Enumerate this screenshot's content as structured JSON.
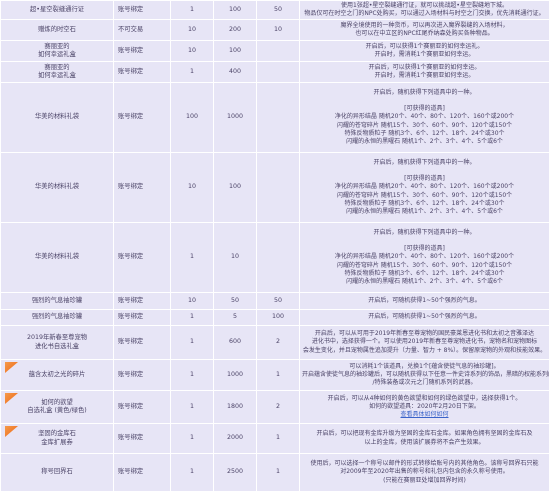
{
  "rows": [
    {
      "name": "超•星空裂缝通行证",
      "trade": "账号绑定",
      "a": "1",
      "b": "100",
      "c": "50",
      "promo": false,
      "desc": [
        "使用1张超•星空裂缝通行证，就可以挑战超•星空裂缝地下城。",
        "物品仅可在时空之门的NPC处购买，可以通过入场材料与时空之门交换，优先消耗通行证。"
      ]
    },
    {
      "name": "赠炼的时空石",
      "trade": "不可交易",
      "a": "10",
      "b": "200",
      "c": "10",
      "promo": false,
      "desc": [
        "魔界全境使用的一种货币，可以再次进入魔界裂缝的入场材料，",
        "也可以在中立区的NPC红尾乔纳森处购买各种物品。"
      ]
    },
    {
      "name": "赛丽亚的\n如何幸运礼盒",
      "trade": "账号绑定",
      "a": "10",
      "b": "100",
      "c": "",
      "promo": false,
      "desc": [
        "开启后，可以获得1个赛丽亚的如何幸运礼。",
        "开启时，需消耗1个赛丽亚如何幸运。"
      ]
    },
    {
      "name": "赛丽亚的\n如何幸运礼盒",
      "trade": "账号绑定",
      "a": "1",
      "b": "400",
      "c": "",
      "promo": false,
      "desc": [
        "开启后，可以获得1个赛丽亚的如何幸运。",
        "开启时，需消耗1个赛丽亚如何幸运。"
      ]
    },
    {
      "name": "华美的材料礼袋",
      "trade": "账号绑定",
      "a": "100",
      "b": "1000",
      "c": "",
      "promo": false,
      "desc": [
        "开启后，随机获得下列道具中的一种。",
        "",
        "[可获得的道具]",
        "净化的异形结晶 随机20个、40个、80个、120个、160个或200个",
        "闪耀的苍穹碎片 随机15个、30个、60个、90个、120个或150个",
        "特殊反物质粒子 随机3个、6个、12个、18个、24个或30个",
        "闪耀的永恒的黑曜石 随机1个、2个、3个、4个、5个或6个"
      ]
    },
    {
      "name": "华美的材料礼袋",
      "trade": "账号绑定",
      "a": "10",
      "b": "100",
      "c": "",
      "promo": false,
      "desc": [
        "开启后，随机获得下列道具中的一种。",
        "",
        "[可获得的道具]",
        "净化的异形结晶 随机20个、40个、80个、120个、160个或200个",
        "闪耀的苍穹碎片 随机15个、30个、60个、90个、120个或150个",
        "特殊反物质粒子 随机3个、6个、12个、18个、24个或30个",
        "闪耀的永恒的黑曜石 随机1个、2个、3个、4个、5个或6个"
      ]
    },
    {
      "name": "华美的材料礼袋",
      "trade": "账号绑定",
      "a": "1",
      "b": "10",
      "c": "",
      "promo": false,
      "desc": [
        "开启后，随机获得下列道具中的一种。",
        "",
        "[可获得的道具]",
        "净化的异形结晶 随机20个、40个、80个、120个、160个或200个",
        "闪耀的苍穹碎片 随机15个、30个、60个、90个、120个或150个",
        "特殊反物质粒子 随机3个、6个、12个、18个、24个或30个",
        "闪耀的永恒的黑曜石 随机1个、2个、3个、4个、5个或6个"
      ]
    },
    {
      "name": "强烈的气息袖珍罐",
      "trade": "账号绑定",
      "a": "10",
      "b": "50",
      "c": "50",
      "promo": false,
      "desc": [
        "开启后，可随机获得1~50个强烈的气息。"
      ]
    },
    {
      "name": "强烈的气息袖珍罐",
      "trade": "账号绑定",
      "a": "1",
      "b": "5",
      "c": "100",
      "promo": false,
      "desc": [
        "开启后，可随机获得1~50个强烈的气息。"
      ]
    },
    {
      "name": "2019年新春至尊宠物\n进化书自选礼盒",
      "trade": "账号绑定",
      "a": "1",
      "b": "600",
      "c": "2",
      "promo": false,
      "desc": [
        "开启后，可以从可用于2019年新春至尊宠物的国民豪莱恩进化书和太初之音雅泽达",
        "进化书中，选择获得一个。可以使用2019年新春至尊宠物进化书，宠物名和宠物图标",
        "会发生变化，并且宠物属性追加提升（力量、智力 + 8%）。保留原宠物的外观和技能效果。"
      ]
    },
    {
      "name": "蕴含太初之光的碎片",
      "trade": "账号绑定",
      "a": "1",
      "b": "1000",
      "c": "1",
      "promo": true,
      "desc": [
        "可以消耗1个该道具，兑换1个[蕴含使徒气息的袖珍罐]。",
        "开启蕴含使徒气息的袖珍罐后，可以随机获得以下任意一件史诗系列的饰品，黑暗的权能系列的首饰",
        "/特殊装备或次元之门随机系列的武器。"
      ]
    },
    {
      "name": "如何的欲望\n自选礼盒 (黄色/绿色)",
      "trade": "账号绑定",
      "a": "1",
      "b": "1800",
      "c": "2",
      "promo": true,
      "desc": [
        "开启后，可以从4种如何的黄色欲望和如何的绿色欲望中，选择获得1个。",
        "如何的欲望道具：2020年2月20日下架。",
        "查看具体如何如何"
      ]
    },
    {
      "name": "坚固的金库石\n金库扩展券",
      "trade": "账号绑定",
      "a": "1",
      "b": "2000",
      "c": "1",
      "promo": true,
      "desc": [
        "开启后，可以把现有金库升级为坚固的金库石金库。如果角色拥有坚固的金库石及",
        "以上的金库，使用该扩展券将不会产生效果。"
      ]
    },
    {
      "name": "称号回界石",
      "trade": "账号绑定",
      "a": "1",
      "b": "2500",
      "c": "1",
      "promo": false,
      "desc": [
        "使用后，可以选择一个称号以邮件的形式转移给账号内的其他角色。该称号回界石只能",
        "对2009年至2020年出售的称号和礼包内包含的永久称号使用。",
        "(只能在赛丽亚处增加回界时间)"
      ]
    }
  ],
  "footnote_link": "查看具体如何如何"
}
